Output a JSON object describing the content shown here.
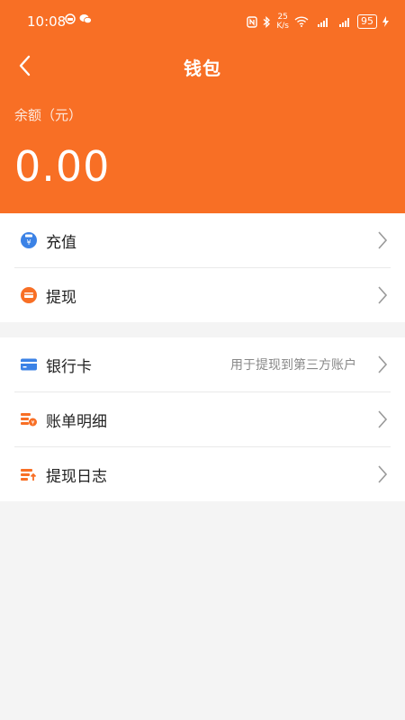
{
  "status_bar": {
    "time": "10:08",
    "left_icons": [
      "notification-icon",
      "wechat-icon"
    ],
    "net_speed_value": "25",
    "net_speed_unit": "K/s",
    "battery": "95",
    "icons": [
      "nfc-icon",
      "bluetooth-icon",
      "wifi-icon",
      "signal-5g-icon",
      "signal-4g-icon",
      "charging-icon"
    ]
  },
  "nav": {
    "title": "钱包",
    "back_icon": "back-arrow-icon"
  },
  "balance": {
    "label": "余额（元）",
    "amount": "0.00"
  },
  "group1": [
    {
      "label": "充值",
      "icon": "recharge-icon",
      "icon_color": "#3b82e6"
    },
    {
      "label": "提现",
      "icon": "withdraw-icon",
      "icon_color": "#f86f25"
    }
  ],
  "group2": [
    {
      "label": "银行卡",
      "icon": "bank-card-icon",
      "note": "用于提现到第三方账户",
      "icon_color": "#3b82e6"
    },
    {
      "label": "账单明细",
      "icon": "bill-detail-icon",
      "icon_color": "#f86f25"
    },
    {
      "label": "提现日志",
      "icon": "withdraw-log-icon",
      "icon_color": "#f86f25"
    }
  ],
  "colors": {
    "accent": "#f86f25",
    "blue": "#3b82e6",
    "background": "#f4f4f4"
  }
}
